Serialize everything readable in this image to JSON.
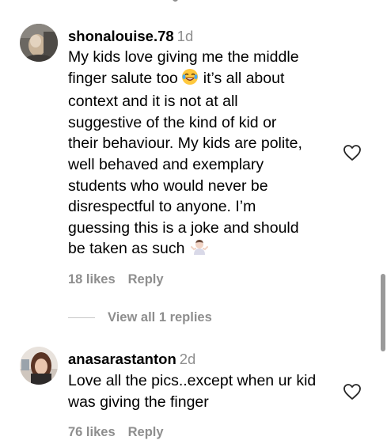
{
  "comments": [
    {
      "username": "shonalouise.78",
      "age": "1d",
      "body_lines": [
        "My kids love giving me the middle",
        "finger salute too",
        "it’s all about",
        "context and it is not at all",
        "suggestive of the kind of kid or",
        "their behaviour. My kids are polite,",
        "well behaved and exemplary",
        "students who would never be",
        "disrespectful to anyone. I’m",
        "guessing this is a joke and should",
        "be taken as such"
      ],
      "emojis": [
        "laughing-tears-emoji",
        "shrugging-woman-emoji"
      ],
      "likes": "18 likes",
      "reply_label": "Reply",
      "view_replies": "View all 1 replies"
    },
    {
      "username": "anasarastanton",
      "age": "2d",
      "body_lines": [
        "Love all the pics..except when ur kid",
        "was giving the finger"
      ],
      "likes": "76 likes",
      "reply_label": "Reply"
    }
  ],
  "icons": {
    "like": "heart-icon",
    "emoji_1": "laughing-tears-emoji",
    "emoji_2": "shrugging-woman-emoji"
  },
  "colors": {
    "text": "#000000",
    "secondary": "#8e8e8e",
    "divider": "#c7c7c7",
    "background": "#ffffff"
  }
}
